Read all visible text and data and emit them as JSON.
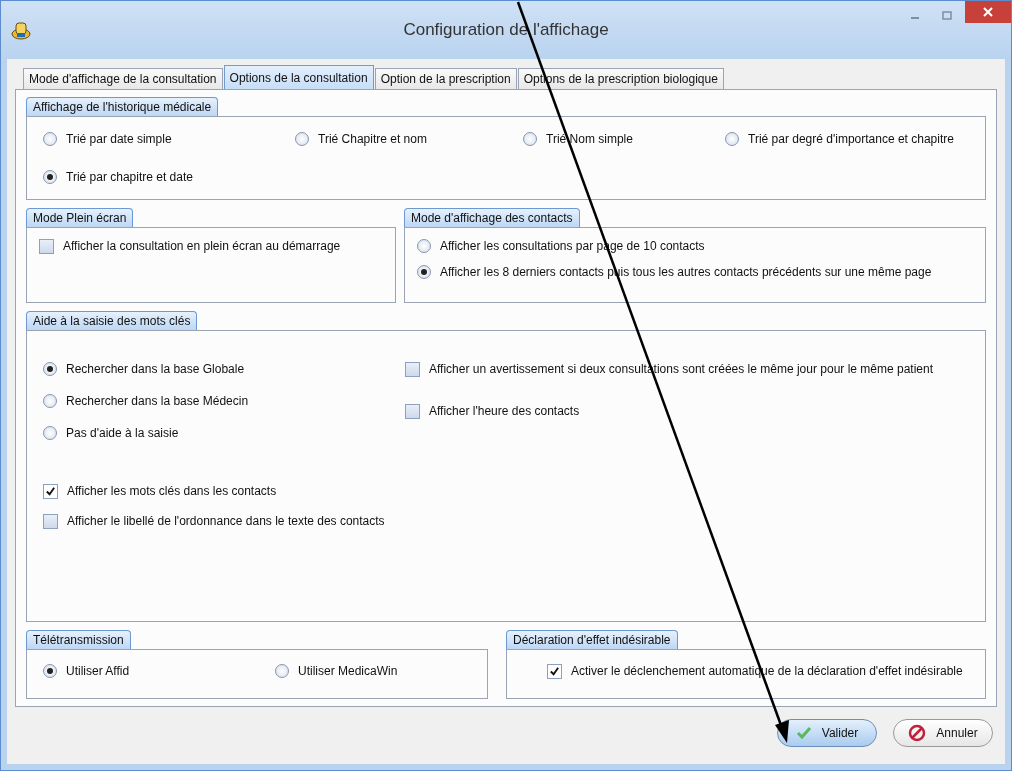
{
  "window": {
    "title": "Configuration de l'affichage"
  },
  "tabs": [
    {
      "label": "Mode d'affichage de la consultation",
      "selected": false
    },
    {
      "label": "Options de la consultation",
      "selected": true
    },
    {
      "label": "Option de la prescription",
      "selected": false
    },
    {
      "label": "Options de la prescription biologique",
      "selected": false
    }
  ],
  "history": {
    "legend": "Affichage de l'historique médicale",
    "options": [
      {
        "label": "Trié par date simple",
        "selected": false
      },
      {
        "label": "Trié Chapitre et nom",
        "selected": false
      },
      {
        "label": "Trié Nom simple",
        "selected": false
      },
      {
        "label": "Trié par degré d'importance et chapitre",
        "selected": false
      },
      {
        "label": "Trié par chapitre et date",
        "selected": true
      }
    ]
  },
  "fullscreen": {
    "legend": "Mode Plein écran",
    "options": [
      {
        "label": "Afficher la consultation en plein écran au démarrage",
        "checked": false
      }
    ]
  },
  "contacts": {
    "legend": "Mode d'affichage des contacts",
    "options": [
      {
        "label": "Afficher les consultations par page de 10 contacts",
        "selected": false
      },
      {
        "label": "Afficher les 8 derniers contacts puis tous les autres contacts précédents sur une même page",
        "selected": true
      }
    ]
  },
  "keywords": {
    "legend": "Aide à la saisie des mots clés",
    "search_options": [
      {
        "label": "Rechercher dans la base Globale",
        "selected": true
      },
      {
        "label": "Rechercher dans la base Médecin",
        "selected": false
      },
      {
        "label": "Pas d'aide à la saisie",
        "selected": false
      }
    ],
    "left_checks": [
      {
        "label": "Afficher les mots clés dans les contacts",
        "checked": true
      },
      {
        "label": "Afficher le libellé de l'ordonnance dans le texte des contacts",
        "checked": false
      }
    ],
    "right_checks": [
      {
        "label": "Afficher un avertissement si deux consultations sont créées le même jour pour le même patient",
        "checked": false
      },
      {
        "label": "Afficher l'heure des contacts",
        "checked": false
      }
    ]
  },
  "teletransmission": {
    "legend": "Télétransmission",
    "options": [
      {
        "label": "Utiliser Affid",
        "selected": true
      },
      {
        "label": "Utiliser MedicaWin",
        "selected": false
      }
    ]
  },
  "adverse": {
    "legend": "Déclaration d'effet indésirable",
    "options": [
      {
        "label": "Activer le déclenchement automatique de la déclaration d'effet indésirable",
        "checked": true
      }
    ]
  },
  "buttons": [
    {
      "label": "Valider",
      "kind": "ok"
    },
    {
      "label": "Annuler",
      "kind": "cancel"
    }
  ]
}
